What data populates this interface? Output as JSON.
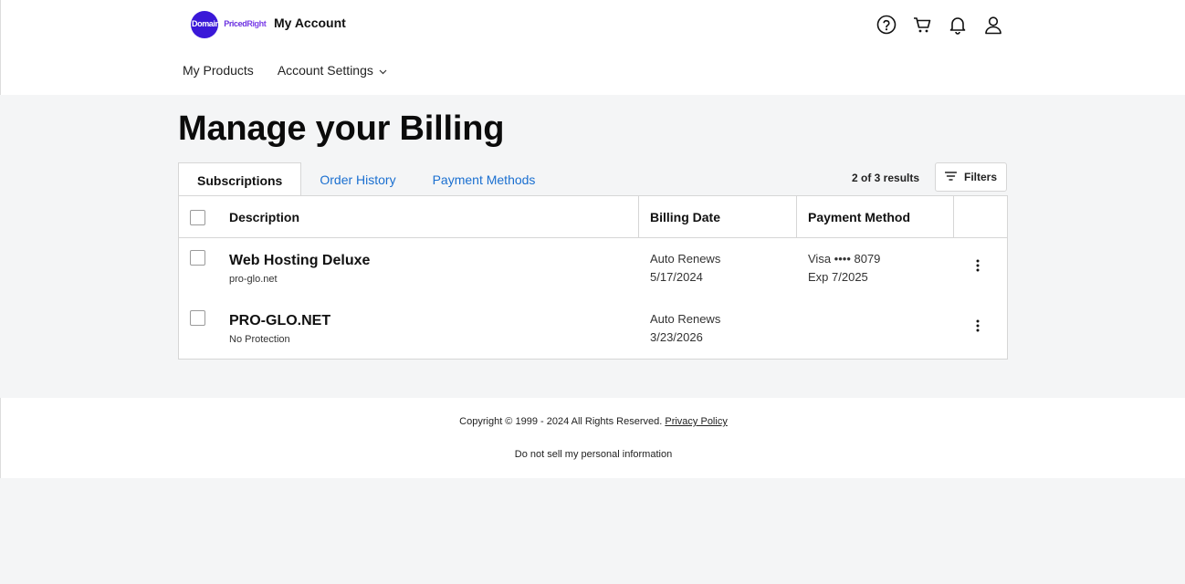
{
  "brand": {
    "logo_part1": "Domains",
    "logo_part2": "Priced",
    "logo_part3": "Right",
    "title": "My Account"
  },
  "header_icons": [
    "help-icon",
    "cart-icon",
    "bell-icon",
    "user-icon"
  ],
  "nav": {
    "my_products": "My Products",
    "account_settings": "Account Settings"
  },
  "page": {
    "title": "Manage your Billing"
  },
  "tabs": [
    {
      "label": "Subscriptions",
      "active": true
    },
    {
      "label": "Order History",
      "active": false
    },
    {
      "label": "Payment Methods",
      "active": false
    }
  ],
  "results_text": "2 of 3 results",
  "filters_label": "Filters",
  "table": {
    "headers": {
      "description": "Description",
      "billing_date": "Billing Date",
      "payment_method": "Payment Method"
    },
    "rows": [
      {
        "name": "Web Hosting Deluxe",
        "sub": "pro-glo.net",
        "billing_status": "Auto Renews",
        "billing_date": "5/17/2024",
        "payment_line1": "Visa •••• 8079",
        "payment_line2": "Exp 7/2025"
      },
      {
        "name": "PRO-GLO.NET",
        "sub": "No Protection",
        "billing_status": "Auto Renews",
        "billing_date": "3/23/2026",
        "payment_line1": "",
        "payment_line2": ""
      }
    ]
  },
  "footer": {
    "copyright": "Copyright © 1999 - 2024 All Rights Reserved.",
    "privacy_policy": "Privacy Policy",
    "do_not_sell": "Do not sell my personal information"
  },
  "colors": {
    "accent": "#1a6fd0",
    "logo_blue": "#3a18d8",
    "background": "#f4f5f6"
  }
}
